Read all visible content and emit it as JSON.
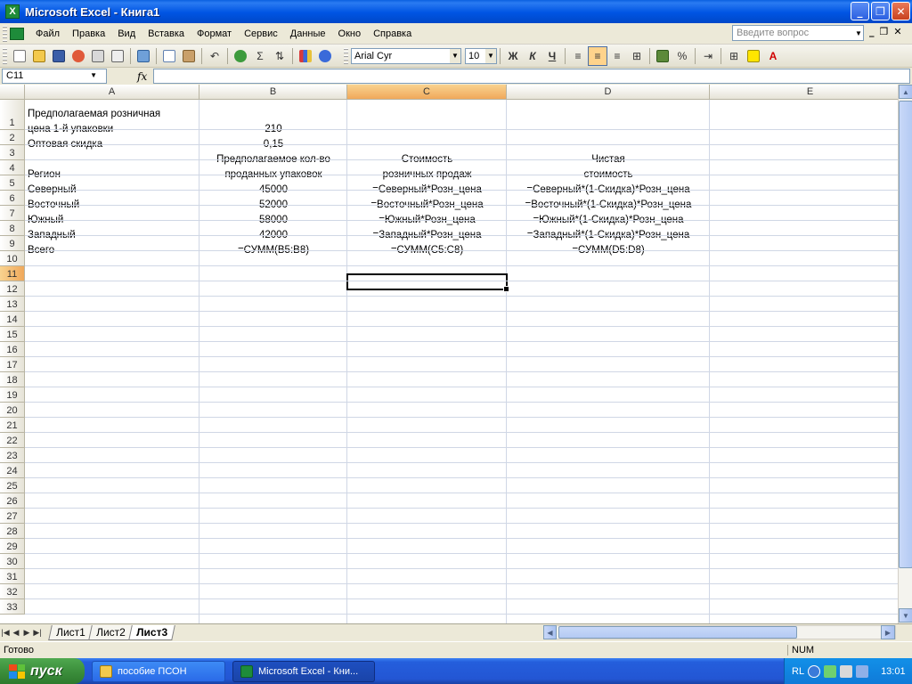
{
  "window": {
    "title": "Microsoft Excel - Книга1",
    "app_icon": "excel-icon"
  },
  "menu": {
    "items": [
      "Файл",
      "Правка",
      "Вид",
      "Вставка",
      "Формат",
      "Сервис",
      "Данные",
      "Окно",
      "Справка"
    ],
    "help_placeholder": "Введите вопрос"
  },
  "toolbar": {
    "font_name": "Arial Cyr",
    "font_size": "10",
    "bold_label": "Ж",
    "italic_label": "К",
    "underline_label": "Ч",
    "sum_label": "Σ",
    "percent_label": "%"
  },
  "formula_bar": {
    "name_box": "C11",
    "fx_label": "fx",
    "formula": ""
  },
  "columns": [
    {
      "label": "A",
      "selected": false
    },
    {
      "label": "B",
      "selected": false
    },
    {
      "label": "C",
      "selected": true
    },
    {
      "label": "D",
      "selected": false
    },
    {
      "label": "E",
      "selected": false
    }
  ],
  "rows": [
    "1",
    "2",
    "3",
    "4",
    "5",
    "6",
    "7",
    "8",
    "9",
    "10",
    "11",
    "12",
    "13",
    "14",
    "15",
    "16",
    "17",
    "18",
    "19",
    "20",
    "21",
    "22",
    "23",
    "24",
    "25",
    "26",
    "27",
    "28",
    "29",
    "30",
    "31",
    "32",
    "33"
  ],
  "selected_row": "11",
  "cells": {
    "A1a": "Предполагаемая розничная",
    "A1b": "цена 1-й упаковки",
    "B1": "210",
    "A2": "Оптовая скидка",
    "B2": "0,15",
    "B3": "Предполагаемое кол-во",
    "C3": "Стоимость",
    "D3": "Чистая",
    "A4": "Регион",
    "B4": "проданных упаковок",
    "C4": "розничных продаж",
    "D4": "стоимость",
    "A5": "Северный",
    "B5": "45000",
    "C5": "=Северный*Розн_цена",
    "D5": "=Северный*(1-Скидка)*Розн_цена",
    "A6": "Восточный",
    "B6": "52000",
    "C6": "=Восточный*Розн_цена",
    "D6": "=Восточный*(1-Скидка)*Розн_цена",
    "A7": "Южный",
    "B7": "58000",
    "C7": "=Южный*Розн_цена",
    "D7": "=Южный*(1-Скидка)*Розн_цена",
    "A8": "Западный",
    "B8": "42000",
    "C8": "=Западный*Розн_цена",
    "D8": "=Западный*(1-Скидка)*Розн_цена",
    "A9": "Всего",
    "B9": "=СУММ(B5:B8)",
    "C9": "=СУММ(C5:C8)",
    "D9": "=СУММ(D5:D8)"
  },
  "sheets": [
    {
      "label": "Лист1",
      "active": false
    },
    {
      "label": "Лист2",
      "active": false
    },
    {
      "label": "Лист3",
      "active": true
    }
  ],
  "status": {
    "text": "Готово",
    "num": "NUM"
  },
  "taskbar": {
    "start_label": "пуск",
    "tasks": [
      {
        "label": "пособие ПСОН",
        "icon": "folder-icon",
        "active": false
      },
      {
        "label": "Microsoft Excel - Кни...",
        "icon": "excel-icon",
        "active": true
      }
    ],
    "lang": "RL",
    "clock": "13:01"
  }
}
